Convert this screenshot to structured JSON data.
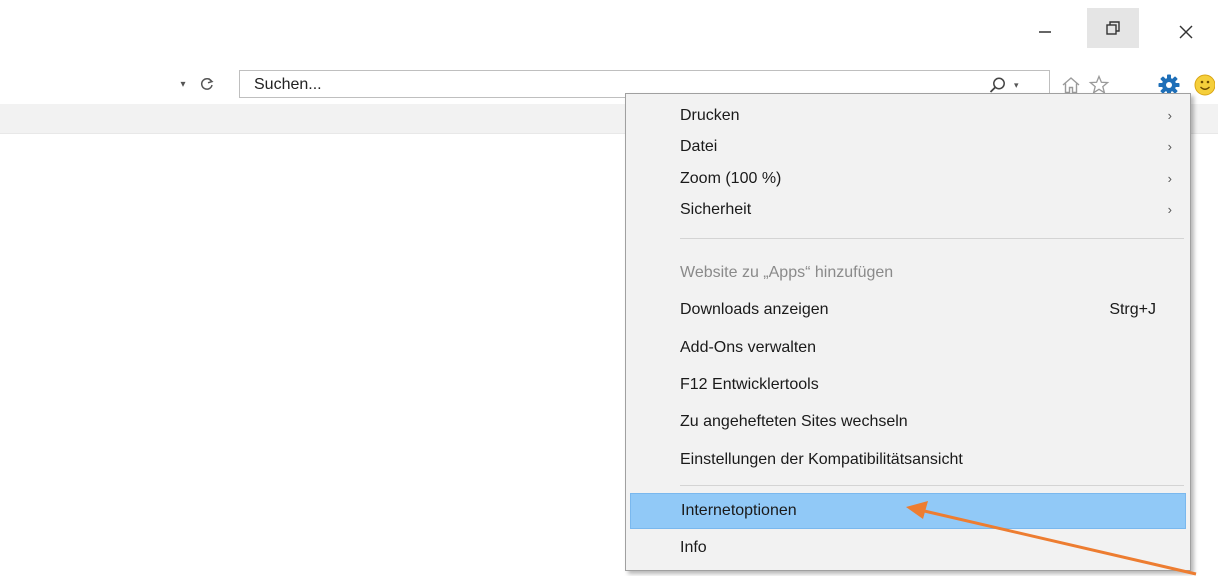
{
  "window": {
    "minimize_icon": "minimize-icon",
    "restore_icon": "restore-icon",
    "close_icon": "close-icon"
  },
  "addressbar": {
    "dropdown_icon": "chevron-down-icon",
    "refresh_icon": "refresh-icon"
  },
  "search": {
    "placeholder": "Suchen...",
    "icon": "search-icon",
    "dropdown_icon": "chevron-down-icon"
  },
  "toolbar": {
    "icons": [
      "home-icon",
      "favorites-star-icon",
      "gear-icon",
      "smiley-feedback-icon"
    ]
  },
  "menu": {
    "items": [
      {
        "label": "Drucken",
        "submenu": true
      },
      {
        "label": "Datei",
        "submenu": true
      },
      {
        "label": "Zoom (100 %)",
        "submenu": true
      },
      {
        "label": "Sicherheit",
        "submenu": true
      },
      {
        "label": "Website zu „Apps“ hinzufügen",
        "disabled": true
      },
      {
        "label": "Downloads anzeigen",
        "shortcut": "Strg+J"
      },
      {
        "label": "Add-Ons verwalten"
      },
      {
        "label": "F12 Entwicklertools"
      },
      {
        "label": "Zu angehefteten Sites wechseln"
      },
      {
        "label": "Einstellungen der Kompatibilitätsansicht"
      },
      {
        "label": "Internetoptionen",
        "highlighted": true
      },
      {
        "label": "Info"
      }
    ],
    "submenu_glyph": "›"
  },
  "colors": {
    "highlight": "#91c9f7",
    "annotation_arrow": "#ed7d31",
    "gear": "#1e6fb8"
  }
}
